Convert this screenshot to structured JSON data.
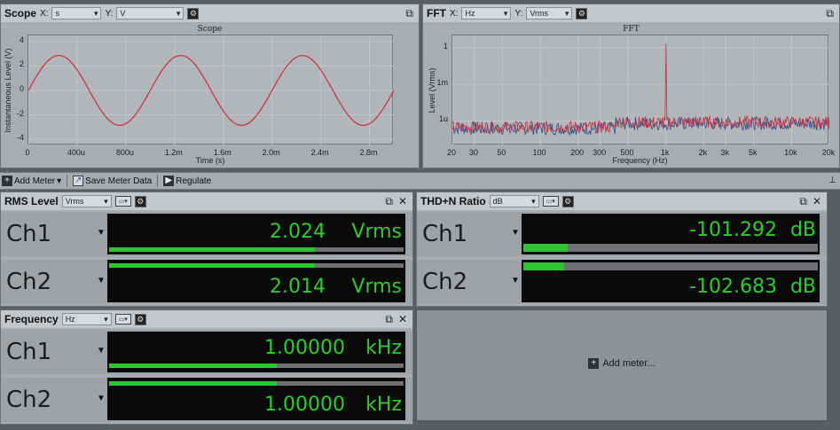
{
  "scope": {
    "title": "Scope",
    "x_label": "X:",
    "x_unit": "s",
    "y_label": "Y:",
    "y_unit": "V",
    "chart_title": "Scope",
    "ylabel": "Instantaneous Level (V)",
    "xlabel": "Time (s)"
  },
  "fft": {
    "title": "FFT",
    "x_label": "X:",
    "x_unit": "Hz",
    "y_label": "Y:",
    "y_unit": "Vrms",
    "chart_title": "FFT",
    "ylabel": "Level (Vrms)",
    "xlabel": "Frequency (Hz)"
  },
  "chart_data": [
    {
      "type": "line",
      "title": "Scope",
      "xlabel": "Time (s)",
      "ylabel": "Instantaneous Level (V)",
      "xlim": [
        0,
        0.003
      ],
      "ylim": [
        -4.5,
        4.5
      ],
      "x_ticks": [
        "0",
        "400u",
        "800u",
        "1.2m",
        "1.6m",
        "2.0m",
        "2.4m",
        "2.8m"
      ],
      "y_ticks": [
        "4",
        "2",
        "0",
        "-2",
        "-4"
      ],
      "series": [
        {
          "amplitude": 2.86,
          "frequency_hz": 1000,
          "phase_deg": 0,
          "color": "#c0394a"
        }
      ]
    },
    {
      "type": "line",
      "title": "FFT",
      "xlabel": "Frequency (Hz)",
      "ylabel": "Level (Vrms)",
      "x_scale": "log",
      "y_scale": "log",
      "xlim": [
        20,
        20000
      ],
      "x_ticks": [
        "20",
        "30",
        "50",
        "100",
        "200",
        "300",
        "500",
        "1k",
        "2k",
        "3k",
        "5k",
        "10k",
        "20k"
      ],
      "y_ticks": [
        "1",
        "1m",
        "1u"
      ],
      "series": [
        {
          "color": "#c0394a",
          "peaks": [
            {
              "x": 1000,
              "y": 2.02
            },
            {
              "x": 2000,
              "y": 2e-06
            },
            {
              "x": 3000,
              "y": 1.5e-06
            }
          ]
        },
        {
          "color": "#2f4a8a"
        }
      ]
    }
  ],
  "toolbar": {
    "add_meter": "Add Meter",
    "save_meter_data": "Save Meter Data",
    "regulate": "Regulate"
  },
  "rms": {
    "title": "RMS Level",
    "unit_select": "Vrms",
    "ch1": {
      "name": "Ch1",
      "value": "2.024",
      "unit": "Vrms",
      "bar_fraction": 0.7
    },
    "ch2": {
      "name": "Ch2",
      "value": "2.014",
      "unit": "Vrms",
      "bar_fraction": 0.7
    }
  },
  "thdn": {
    "title": "THD+N Ratio",
    "unit_select": "dB",
    "ch1": {
      "name": "Ch1",
      "value": "-101.292",
      "unit": "dB",
      "bar_fraction": 0.15
    },
    "ch2": {
      "name": "Ch2",
      "value": "-102.683",
      "unit": "dB",
      "bar_fraction": 0.14
    }
  },
  "freq": {
    "title": "Frequency",
    "unit_select": "Hz",
    "ch1": {
      "name": "Ch1",
      "value": "1.00000",
      "unit": "kHz",
      "bar_fraction": 0.57
    },
    "ch2": {
      "name": "Ch2",
      "value": "1.00000",
      "unit": "kHz",
      "bar_fraction": 0.57
    }
  },
  "add_meter_panel": {
    "label": "Add meter..."
  },
  "icons": {
    "popout": "popout-icon",
    "close": "close-icon",
    "settings": "gear-icon",
    "plus": "plus-icon"
  }
}
